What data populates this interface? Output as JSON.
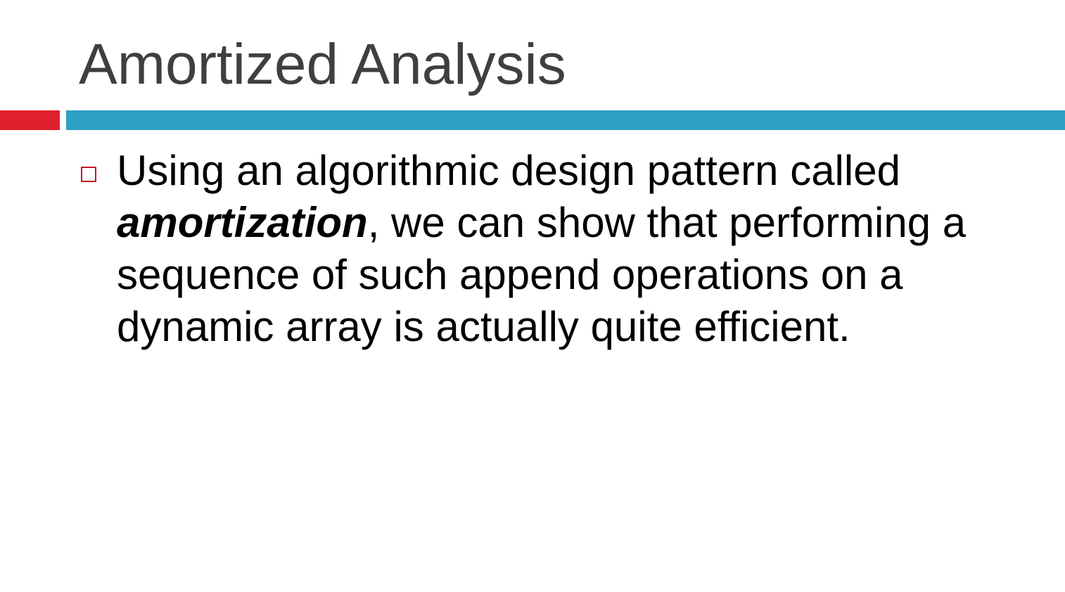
{
  "slide": {
    "title": "Amortized Analysis",
    "bullet": {
      "text_before": "Using an algorithmic design pattern called ",
      "emphasis": "amortization",
      "text_after": ", we can show that performing a sequence of such append operations on a dynamic array is actually quite efficient."
    }
  },
  "colors": {
    "accent_red": "#e0202e",
    "accent_blue": "#2ea0c3",
    "bullet_border": "#c6182a",
    "title_color": "#3f3f3f",
    "body_color": "#000000"
  },
  "icons": {
    "bullet": "hollow-square-bullet-icon"
  }
}
